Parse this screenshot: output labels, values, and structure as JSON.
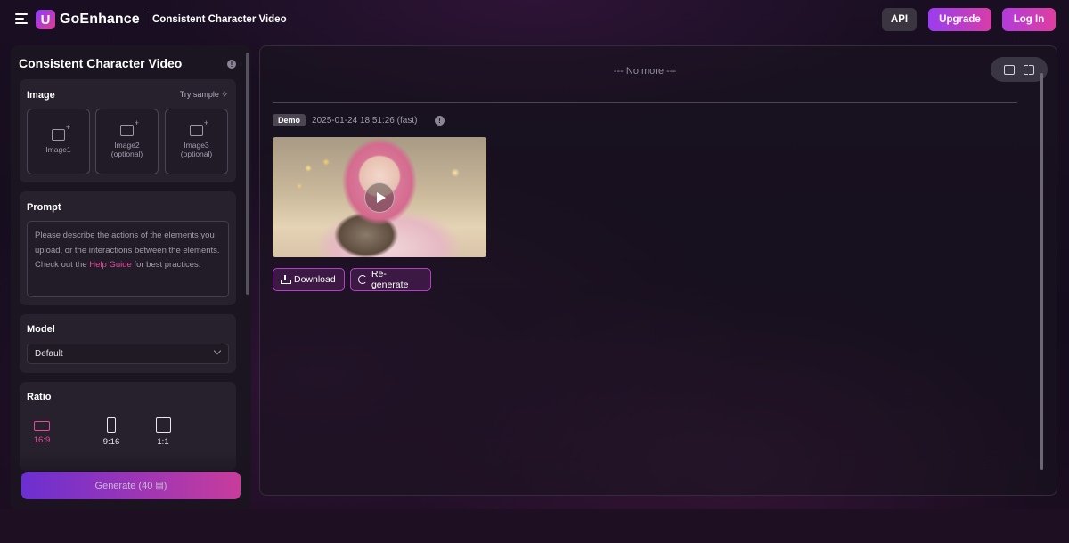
{
  "header": {
    "logo_mark": "U",
    "logo_text": "GoEnhance",
    "page_title": "Consistent Character Video",
    "api_label": "API",
    "upgrade_label": "Upgrade",
    "login_label": "Log In"
  },
  "left_panel": {
    "title": "Consistent Character Video",
    "image": {
      "label": "Image",
      "try_sample": "Try sample",
      "slots": [
        {
          "label": "Image1",
          "sub": ""
        },
        {
          "label": "Image2",
          "sub": "(optional)"
        },
        {
          "label": "Image3",
          "sub": "(optional)"
        }
      ]
    },
    "prompt": {
      "label": "Prompt",
      "placeholder_before": "Please describe the actions of the elements you upload, or the interactions between the elements. Check out the ",
      "help_link": "Help Guide",
      "placeholder_after": " for best practices."
    },
    "model": {
      "label": "Model",
      "selected": "Default"
    },
    "ratio": {
      "label": "Ratio",
      "options": [
        {
          "label": "16:9",
          "active": true
        },
        {
          "label": "9:16",
          "active": false
        },
        {
          "label": "1:1",
          "active": false
        }
      ]
    },
    "generate_label": "Generate (40",
    "generate_suffix": ")"
  },
  "results": {
    "no_more": "--- No more ---",
    "item": {
      "badge": "Demo",
      "timestamp": "2025-01-24 18:51:26 (fast)",
      "download_label": "Download",
      "regenerate_label": "Re-generate"
    }
  },
  "colors": {
    "accent_pink": "#e14c9e",
    "accent_purple": "#9a3df0"
  }
}
